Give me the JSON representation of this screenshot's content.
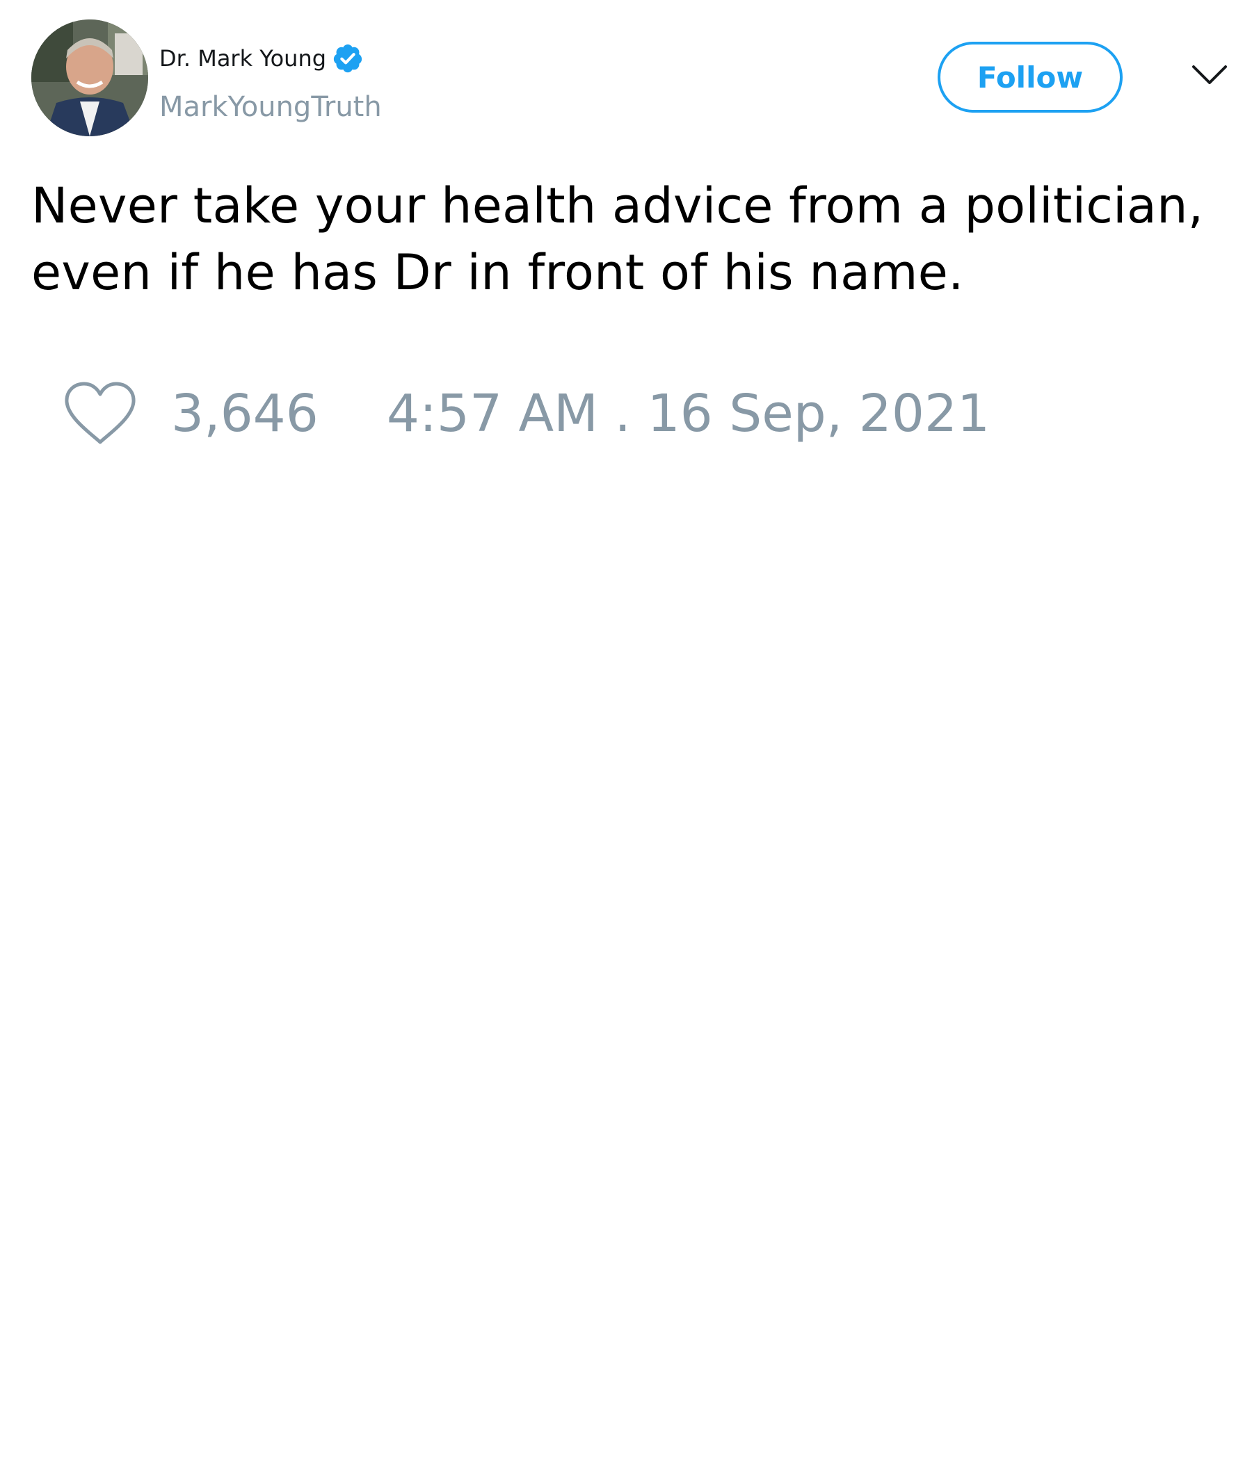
{
  "author": {
    "display_name": "Dr. Mark Young",
    "handle": "MarkYoungTruth",
    "verified_icon": "verified-badge-icon",
    "avatar": "profile-photo"
  },
  "actions": {
    "follow_label": "Follow",
    "menu_icon": "chevron-down-icon"
  },
  "tweet": {
    "text_lines": [
      "Never take your health advice from a politician,",
      "even if he has Dr in front of his name."
    ]
  },
  "footer": {
    "like_icon": "heart-outline-icon",
    "like_count": "3,646",
    "timestamp": "4:57 AM . 16 Sep, 2021"
  },
  "colors": {
    "accent": "#1da1f2",
    "muted": "#8899a6",
    "text": "#000000",
    "background": "#ffffff"
  }
}
